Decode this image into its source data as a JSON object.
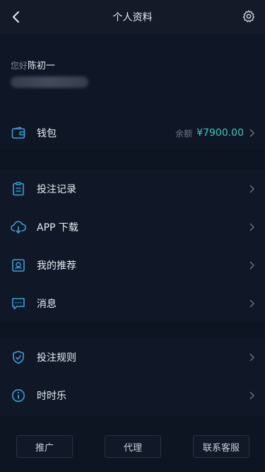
{
  "header": {
    "title": "个人资料",
    "back_icon": "chevron-left-icon",
    "settings_icon": "gear-icon"
  },
  "profile": {
    "greeting": "您好",
    "name": "陈初一"
  },
  "wallet": {
    "label": "钱包",
    "balance_label": "余额",
    "balance_value": "¥7900.00",
    "icon": "wallet-icon"
  },
  "menu_group1": [
    {
      "label": "投注记录",
      "icon": "clipboard-icon"
    },
    {
      "label": "APP 下载",
      "icon": "cloud-download-icon"
    },
    {
      "label": "我的推荐",
      "icon": "referral-icon"
    },
    {
      "label": "消息",
      "icon": "message-icon"
    }
  ],
  "menu_group2": [
    {
      "label": "投注规则",
      "icon": "shield-check-icon"
    },
    {
      "label": "时时乐",
      "icon": "info-icon"
    }
  ],
  "footer": {
    "promote": "推广",
    "agent": "代理",
    "support": "联系客服"
  },
  "colors": {
    "accent": "#36c8c0",
    "icon": "#3a9fd6",
    "background": "#0d1422"
  }
}
